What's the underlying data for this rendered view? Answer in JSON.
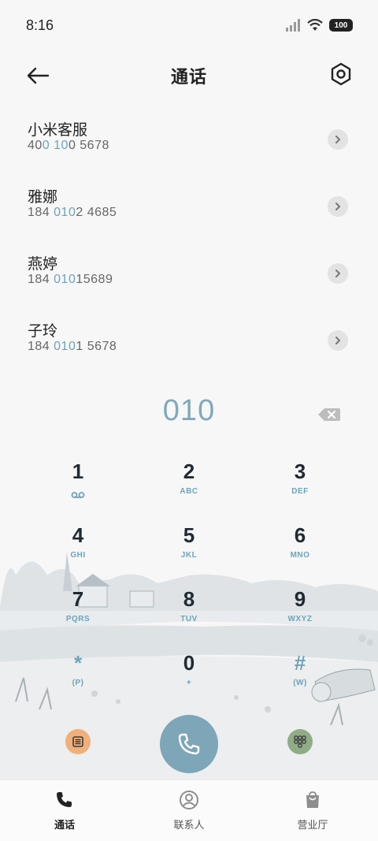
{
  "status_bar": {
    "time": "8:16",
    "battery": "100"
  },
  "header": {
    "title": "通话"
  },
  "contacts": [
    {
      "name": "小米客服",
      "num_pre": "40",
      "num_hl": "0 10",
      "num_post": "0 5678"
    },
    {
      "name": "雅娜",
      "num_pre": "184 ",
      "num_hl": "010",
      "num_post": "2 4685"
    },
    {
      "name": "燕婷",
      "num_pre": "184 ",
      "num_hl": "010",
      "num_post": "15689"
    },
    {
      "name": "子玲",
      "num_pre": "184 ",
      "num_hl": "010",
      "num_post": "1 5678"
    }
  ],
  "dialer": {
    "display": "010",
    "keys": [
      {
        "digit": "1",
        "sub": ""
      },
      {
        "digit": "2",
        "sub": "ABC"
      },
      {
        "digit": "3",
        "sub": "DEF"
      },
      {
        "digit": "4",
        "sub": "GHI"
      },
      {
        "digit": "5",
        "sub": "JKL"
      },
      {
        "digit": "6",
        "sub": "MNO"
      },
      {
        "digit": "7",
        "sub": "PQRS"
      },
      {
        "digit": "8",
        "sub": "TUV"
      },
      {
        "digit": "9",
        "sub": "WXYZ"
      },
      {
        "digit": "*",
        "sub": "(P)"
      },
      {
        "digit": "0",
        "sub": "+"
      },
      {
        "digit": "#",
        "sub": "(W)"
      }
    ]
  },
  "tabs": [
    {
      "label": "通话",
      "icon": "phone-icon"
    },
    {
      "label": "联系人",
      "icon": "person-icon"
    },
    {
      "label": "营业厅",
      "icon": "bag-icon"
    }
  ],
  "colors": {
    "accent": "#7da6b8",
    "highlight": "#6fa3b8",
    "menu": "#f1b07b",
    "pad": "#8fac86"
  }
}
